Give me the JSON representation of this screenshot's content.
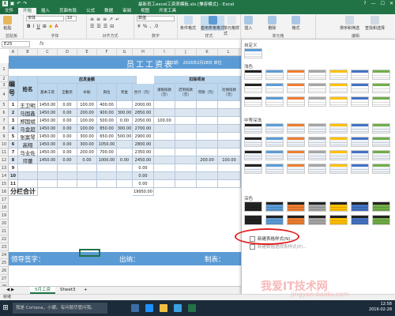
{
  "titlebar": {
    "title": "最新员工excel工资表模板.xls [兼容模式] - Excel",
    "wc": [
      "?",
      "—",
      "☐",
      "✕"
    ]
  },
  "tabs": [
    "文件",
    "开始",
    "插入",
    "页面布局",
    "公式",
    "数据",
    "审阅",
    "视图",
    "开发工具"
  ],
  "ribbon": {
    "font_name": "宋体",
    "font_size": "10",
    "number_format": "数值",
    "groups": [
      "剪贴板",
      "字体",
      "对齐方式",
      "数字",
      "样式",
      "单元格",
      "编辑"
    ],
    "buttons": [
      "条件格式",
      "套用表格格式",
      "单元格样式",
      "插入",
      "删除",
      "格式",
      "排序和筛选",
      "查找和选择"
    ],
    "paste_label": "粘贴"
  },
  "formula": {
    "namebox": "E25",
    "fx": "fx"
  },
  "columns": [
    "A",
    "B",
    "C",
    "D",
    "E",
    "F",
    "G",
    "H",
    "I",
    "J",
    "K",
    "L",
    "M",
    "N"
  ],
  "sheet": {
    "title": "员工工资表",
    "date": "日期： 2016年2月28日  单位",
    "headers": {
      "no": "编号",
      "name": "姓名",
      "yingfa": "应发金额",
      "koujian": "扣除项目",
      "base": "基本工资",
      "allow": "全勤奖",
      "subsidy": "补助",
      "post": "岗位",
      "bonus": "奖金",
      "total": "合计（元）",
      "leave": "请假扣款（元）",
      "late": "迟到扣款（元）",
      "social": "罚款（元）",
      "fee": "社保扣款（元）"
    },
    "rows": [
      {
        "no": "1",
        "name": "王卫明",
        "c": [
          "1450.00",
          "0.00",
          "100.00",
          "400.00",
          "",
          "2000.00",
          "",
          "",
          "",
          ""
        ]
      },
      {
        "no": "2",
        "name": "马国鑫",
        "c": [
          "1450.00",
          "0.00",
          "200.00",
          "900.00",
          "300.00",
          "2850.00",
          "",
          "",
          "",
          ""
        ]
      },
      {
        "no": "3",
        "name": "郑国斌",
        "c": [
          "1450.00",
          "0.00",
          "100.00",
          "500.00",
          "0.00",
          "2050.00",
          "100.00",
          "",
          "",
          ""
        ]
      },
      {
        "no": "4",
        "name": "马金超",
        "c": [
          "1450.00",
          "0.00",
          "100.00",
          "850.00",
          "300.00",
          "2700.00",
          "",
          "",
          "",
          ""
        ]
      },
      {
        "no": "5",
        "name": "张案琴",
        "c": [
          "1450.00",
          "0.00",
          "300.00",
          "650.00",
          "500.00",
          "2900.00",
          "",
          "",
          "",
          ""
        ]
      },
      {
        "no": "6",
        "name": "高翔",
        "c": [
          "1450.00",
          "0.00",
          "300.00",
          "1050.00",
          "",
          "2800.00",
          "",
          "",
          "",
          ""
        ]
      },
      {
        "no": "7",
        "name": "马业佐",
        "c": [
          "1450.00",
          "0.00",
          "200.00",
          "700.00",
          "",
          "2350.00",
          "",
          "",
          "",
          ""
        ]
      },
      {
        "no": "8",
        "name": "邓蕾",
        "c": [
          "1450.00",
          "0.00",
          "0.00",
          "1000.00",
          "0.00",
          "2450.00",
          "",
          "",
          "200.00",
          "100.00"
        ]
      },
      {
        "no": "9",
        "name": "",
        "c": [
          "",
          "",
          "",
          "",
          "",
          "0.00",
          "",
          "",
          "",
          ""
        ]
      },
      {
        "no": "10",
        "name": "",
        "c": [
          "",
          "",
          "",
          "",
          "",
          "0.00",
          "",
          "",
          "",
          ""
        ]
      },
      {
        "no": "11",
        "name": "",
        "c": [
          "",
          "",
          "",
          "",
          "",
          "0.00",
          "",
          "",
          "",
          ""
        ]
      }
    ],
    "subtotal_label": "分栏合计",
    "subtotal_value": "19950.00",
    "sig": {
      "leader": "领导签字：",
      "cashier": "出纳：",
      "maker": "制表："
    }
  },
  "row_numbers": [
    "1",
    "2",
    "3",
    "4",
    "5",
    "6",
    "7",
    "8",
    "9",
    "10",
    "11",
    "12",
    "13",
    "14",
    "15",
    "16",
    "17",
    "18",
    "19",
    "20",
    "21",
    "22",
    "23",
    "24",
    "25",
    "26",
    "27",
    "28",
    "29",
    "30"
  ],
  "sheettabs": {
    "active": "5月工资",
    "other": "Sheet3",
    "add": "+"
  },
  "status": "就绪",
  "panel": {
    "sections": [
      "自定义",
      "浅色",
      "中等深浅",
      "深色"
    ],
    "menu_new": "新建表格样式(N)...",
    "menu_new_pivot": "新建数据透视表样式(P)..."
  },
  "taskbar": {
    "search": "我是 Cortana，小娜。有问题尽管问我。",
    "time": "12:58",
    "date": "2016-02-28"
  },
  "watermark": {
    "text": "我爱IT技术网",
    "url": "jingyan.baidu.com"
  }
}
